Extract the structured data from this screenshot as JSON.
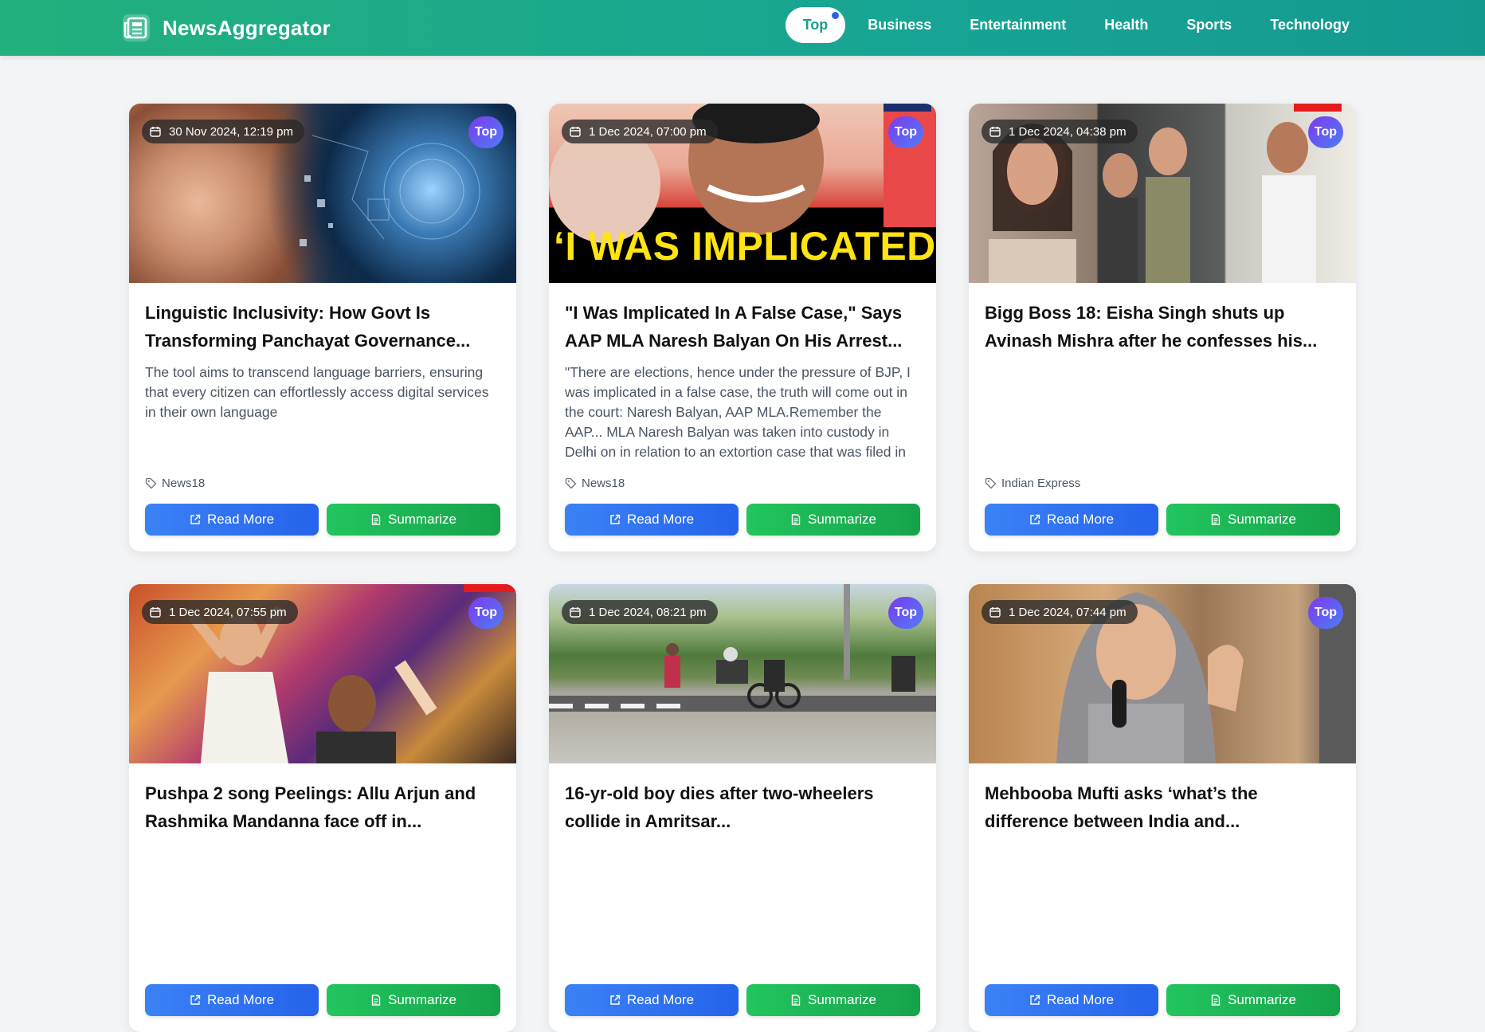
{
  "header": {
    "brand": "NewsAggregator",
    "nav": [
      {
        "label": "Top",
        "active": true
      },
      {
        "label": "Business",
        "active": false
      },
      {
        "label": "Entertainment",
        "active": false
      },
      {
        "label": "Health",
        "active": false
      },
      {
        "label": "Sports",
        "active": false
      },
      {
        "label": "Technology",
        "active": false
      }
    ],
    "colors": {
      "bar_start": "#22b07d",
      "bar_end": "#14998f",
      "active_text": "#16a085"
    }
  },
  "cards": [
    {
      "date": "30 Nov 2024, 12:19 pm",
      "badge": "Top",
      "title": "Linguistic Inclusivity: How Govt Is Transforming Panchayat Governance...",
      "description": "The tool aims to transcend language barriers, ensuring that every citizen can effortlessly access digital services in their own language",
      "source": "News18",
      "read_more": "Read More",
      "summarize": "Summarize",
      "image": "tech-face"
    },
    {
      "date": "1 Dec 2024, 07:00 pm",
      "badge": "Top",
      "title": "\"I Was Implicated In A False Case,\" Says AAP MLA Naresh Balyan On His Arrest...",
      "description": "\"There are elections, hence under the pressure of BJP, I was implicated in a false case, the truth will come out in the court: Naresh Balyan, AAP MLA.Remember the AAP... MLA Naresh Balyan was taken into custody in Delhi on in relation to an extortion case that was filed in the previous",
      "source": "News18",
      "read_more": "Read More",
      "summarize": "Summarize",
      "image": "politician-headline",
      "image_text": "‘I WAS IMPLICATED"
    },
    {
      "date": "1 Dec 2024, 04:38 pm",
      "badge": "Top",
      "title": "Bigg Boss 18: Eisha Singh shuts up Avinash Mishra after he confesses his...",
      "description": "",
      "source": "Indian Express",
      "read_more": "Read More",
      "summarize": "Summarize",
      "image": "tv-collage"
    },
    {
      "date": "1 Dec 2024, 07:55 pm",
      "badge": "Top",
      "title": "Pushpa 2 song Peelings: Allu Arjun and Rashmika Mandanna face off in...",
      "description": "",
      "source": "",
      "read_more": "Read More",
      "summarize": "Summarize",
      "image": "dance"
    },
    {
      "date": "1 Dec 2024, 08:21 pm",
      "badge": "Top",
      "title": "16-yr-old boy dies after two-wheelers collide in Amritsar...",
      "description": "",
      "source": "",
      "read_more": "Read More",
      "summarize": "Summarize",
      "image": "street"
    },
    {
      "date": "1 Dec 2024, 07:44 pm",
      "badge": "Top",
      "title": "Mehbooba Mufti asks ‘what’s the difference between India and...",
      "description": "",
      "source": "",
      "read_more": "Read More",
      "summarize": "Summarize",
      "image": "speaker"
    }
  ]
}
